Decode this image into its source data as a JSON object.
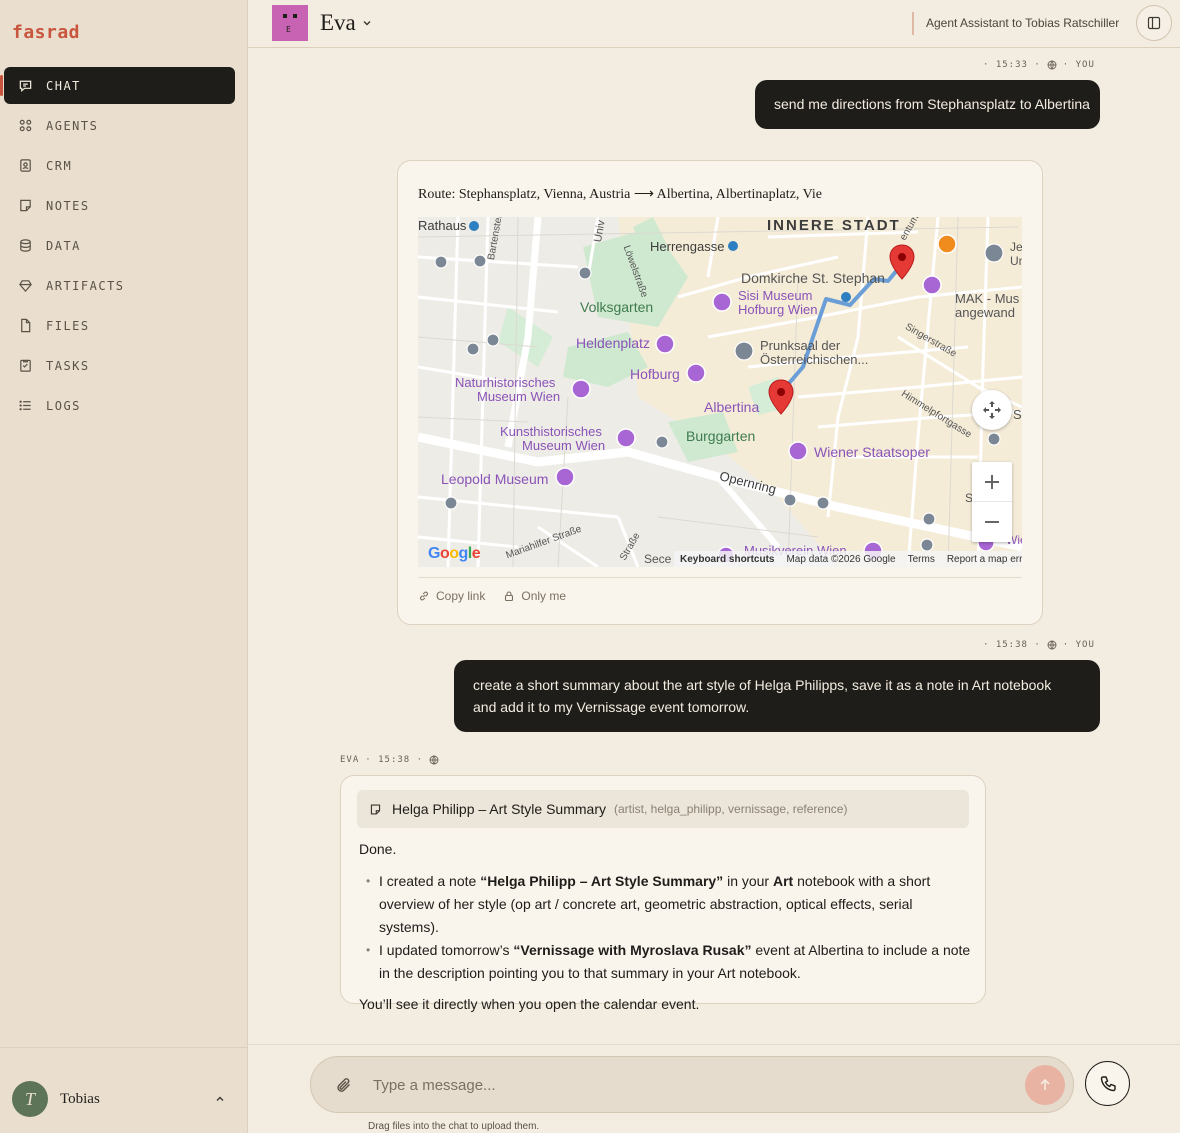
{
  "app": {
    "brand": "fasrad"
  },
  "nav": {
    "items": [
      {
        "label": "CHAT",
        "icon": "chat-bubble-icon"
      },
      {
        "label": "AGENTS",
        "icon": "grid-icon"
      },
      {
        "label": "CRM",
        "icon": "contact-card-icon"
      },
      {
        "label": "NOTES",
        "icon": "note-icon"
      },
      {
        "label": "DATA",
        "icon": "database-icon"
      },
      {
        "label": "ARTIFACTS",
        "icon": "gem-icon"
      },
      {
        "label": "FILES",
        "icon": "file-icon"
      },
      {
        "label": "TASKS",
        "icon": "clipboard-icon"
      },
      {
        "label": "LOGS",
        "icon": "list-icon"
      }
    ]
  },
  "user": {
    "initial": "T",
    "name": "Tobias"
  },
  "header": {
    "agent_initial": "E",
    "agent_name": "Eva",
    "subtitle": "Agent Assistant to Tobias Ratschiller"
  },
  "messages": {
    "m1": {
      "time": "· 15:33 ·",
      "who": "· YOU",
      "text": "send me directions from Stephansplatz to Albertina"
    },
    "map_card": {
      "route": "Route: Stephansplatz, Vienna, Austria ⟶ Albertina, Albertinaplatz, Vie",
      "copy_link": "Copy link",
      "visibility": "Only me"
    },
    "m2": {
      "time": "· 15:38 ·",
      "who": "· YOU",
      "text": "create a short summary about the art style of Helga Philipps, save it as a note in Art notebook and add it to my Vernissage event tomorrow."
    },
    "reply": {
      "who": "EVA",
      "time": "· 15:38 ·",
      "note_title": "Helga Philipp – Art Style Summary",
      "note_tags": "(artist, helga_philipp, vernissage, reference)",
      "intro": "Done.",
      "b1_pre": "I created a note ",
      "b1_bold1": "“Helga Philipp – Art Style Summary”",
      "b1_mid": " in your ",
      "b1_bold2": "Art",
      "b1_post": " notebook with a short overview of her style (op art / concrete art, geometric abstraction, optical effects, serial systems).",
      "b2_pre": "I updated tomorrow’s ",
      "b2_bold": "“Vernissage with Myroslava Rusak”",
      "b2_post": " event at Albertina to include a note in the description pointing you to that summary in your Art notebook.",
      "outro": "You’ll see it directly when you open the calendar event."
    }
  },
  "map": {
    "labels": {
      "innere_stadt": "INNERE STADT",
      "rathaus": "Rathaus",
      "herrengasse": "Herrengasse",
      "domkirche": "Domkirche St. Stephan",
      "volksgarten": "Volksgarten",
      "sisi1": "Sisi Museum",
      "sisi2": "Hofburg Wien",
      "mak1": "MAK - Mus",
      "mak2": "angewand",
      "heldenplatz": "Heldenplatz",
      "prunksaal1": "Prunksaal der",
      "prunksaal2": "Österreichischen...",
      "singerstrasse": "Singerstraße",
      "nhm1": "Naturhistorisches",
      "nhm2": "Museum Wien",
      "hofburg": "Hofburg",
      "albertina": "Albertina",
      "himmelpfort": "Himmelpfortgasse",
      "khm1": "Kunsthistorisches",
      "khm2": "Museum Wien",
      "burggarten": "Burggarten",
      "staatsoper": "Wiener Staatsoper",
      "leopold": "Leopold Museum",
      "opernring": "Opernring",
      "mariahilfer": "Mariahilfer Straße",
      "musikverein": "Musikverein Wien",
      "bartenstein": "Bartensteingasse",
      "loewel": "Löwelstraße",
      "univ": "Univ",
      "je": "Je",
      "un": "Un",
      "s1": "S",
      "sk": "S   rk",
      "wie": "Wie",
      "sec": "Sece",
      "strasse": "Straße",
      "entum": "entum."
    },
    "footer": {
      "shortcuts": "Keyboard shortcuts",
      "data": "Map data ©2026 Google",
      "terms": "Terms",
      "report": "Report a map error"
    },
    "logo": "Google",
    "colors": {
      "route": "#6b9ed6",
      "pin": "#e53935",
      "poi": "#a866d4"
    }
  },
  "composer": {
    "placeholder": "Type a message...",
    "hint": "Drag files into the chat to upload them."
  },
  "colors": {
    "accent": "#c8553d",
    "dark": "#1f1d1a",
    "agent_avatar": "#c862b3"
  }
}
